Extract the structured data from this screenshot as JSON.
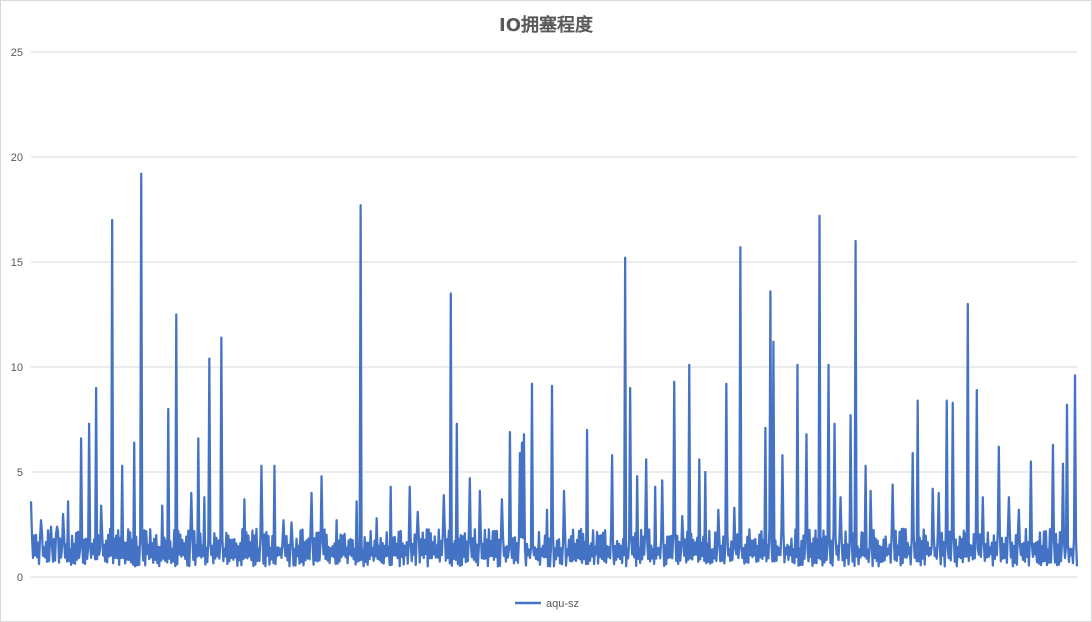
{
  "chart_data": {
    "type": "line",
    "title": "IO拥塞程度",
    "xlabel": "",
    "ylabel": "",
    "ylim": [
      0,
      25
    ],
    "yticks": [
      0,
      5,
      10,
      15,
      20,
      25
    ],
    "grid": true,
    "legend_position": "bottom",
    "series": [
      {
        "name": "aqu-sz",
        "color": "#4472C4",
        "spikes": [
          [
            0,
            3.6
          ],
          [
            10,
            2.7
          ],
          [
            20,
            2.4
          ],
          [
            26,
            2.4
          ],
          [
            32,
            3.0
          ],
          [
            37,
            3.6
          ],
          [
            50,
            6.6
          ],
          [
            58,
            7.3
          ],
          [
            65,
            9.0
          ],
          [
            70,
            3.4
          ],
          [
            81,
            17.0
          ],
          [
            91,
            5.3
          ],
          [
            103,
            6.4
          ],
          [
            110,
            19.2
          ],
          [
            131,
            3.4
          ],
          [
            137,
            8.0
          ],
          [
            145,
            12.5
          ],
          [
            160,
            4.0
          ],
          [
            167,
            6.6
          ],
          [
            173,
            3.8
          ],
          [
            178,
            10.4
          ],
          [
            190,
            11.4
          ],
          [
            213,
            3.7
          ],
          [
            230,
            5.3
          ],
          [
            243,
            5.3
          ],
          [
            252,
            2.7
          ],
          [
            260,
            2.6
          ],
          [
            280,
            4.0
          ],
          [
            290,
            4.8
          ],
          [
            305,
            2.7
          ],
          [
            325,
            3.6
          ],
          [
            329,
            17.7
          ],
          [
            345,
            2.8
          ],
          [
            359,
            4.3
          ],
          [
            378,
            4.3
          ],
          [
            386,
            3.1
          ],
          [
            412,
            3.9
          ],
          [
            419,
            13.5
          ],
          [
            425,
            7.3
          ],
          [
            438,
            4.7
          ],
          [
            448,
            4.1
          ],
          [
            470,
            3.7
          ],
          [
            478,
            6.9
          ],
          [
            488,
            5.9
          ],
          [
            490,
            6.4
          ],
          [
            492,
            6.8
          ],
          [
            500,
            9.2
          ],
          [
            515,
            3.2
          ],
          [
            520,
            9.1
          ],
          [
            532,
            4.1
          ],
          [
            555,
            7.0
          ],
          [
            580,
            5.8
          ],
          [
            593,
            15.2
          ],
          [
            598,
            9.0
          ],
          [
            605,
            4.8
          ],
          [
            614,
            5.6
          ],
          [
            623,
            4.3
          ],
          [
            630,
            4.6
          ],
          [
            642,
            9.3
          ],
          [
            650,
            2.9
          ],
          [
            657,
            10.1
          ],
          [
            667,
            5.6
          ],
          [
            673,
            5.0
          ],
          [
            686,
            3.2
          ],
          [
            694,
            9.2
          ],
          [
            702,
            3.3
          ],
          [
            708,
            15.7
          ],
          [
            733,
            7.1
          ],
          [
            738,
            13.6
          ],
          [
            741,
            11.2
          ],
          [
            750,
            5.8
          ],
          [
            765,
            10.1
          ],
          [
            774,
            6.8
          ],
          [
            787,
            17.2
          ],
          [
            796,
            10.1
          ],
          [
            802,
            7.3
          ],
          [
            808,
            3.8
          ],
          [
            818,
            7.7
          ],
          [
            823,
            16.0
          ],
          [
            833,
            5.3
          ],
          [
            838,
            4.1
          ],
          [
            860,
            4.4
          ],
          [
            880,
            5.9
          ],
          [
            885,
            8.4
          ],
          [
            900,
            4.2
          ],
          [
            906,
            4.0
          ],
          [
            914,
            8.4
          ],
          [
            920,
            8.3
          ],
          [
            935,
            13.0
          ],
          [
            944,
            8.9
          ],
          [
            950,
            3.8
          ],
          [
            966,
            6.2
          ],
          [
            976,
            3.8
          ],
          [
            986,
            3.2
          ],
          [
            998,
            5.5
          ],
          [
            1020,
            6.3
          ],
          [
            1030,
            5.4
          ],
          [
            1034,
            8.2
          ],
          [
            1042,
            9.6
          ]
        ],
        "baseline_typical": [
          0.5,
          2.3
        ]
      }
    ]
  }
}
